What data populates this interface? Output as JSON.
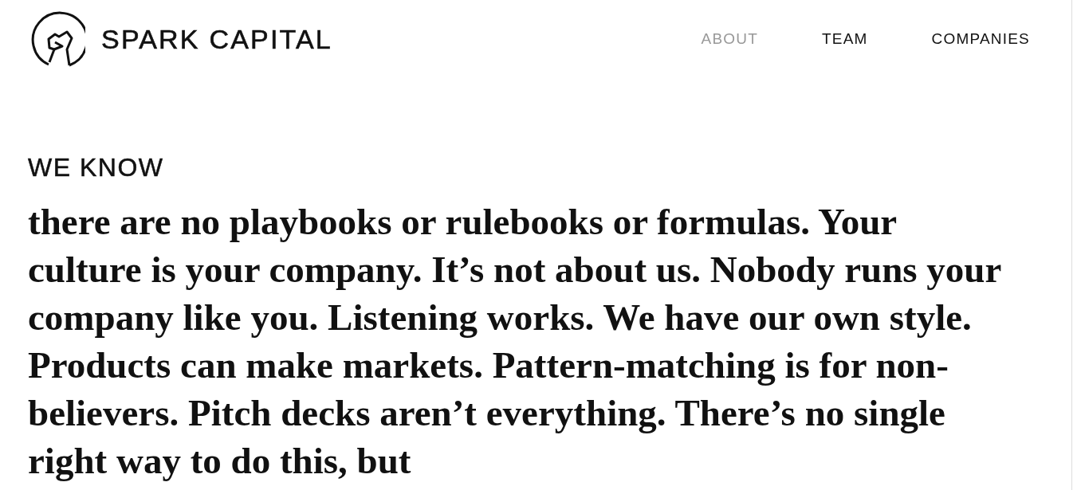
{
  "header": {
    "logo_text": "SPARK CAPITAL",
    "nav": [
      {
        "label": "ABOUT",
        "selected": true
      },
      {
        "label": "TEAM",
        "selected": false
      },
      {
        "label": "COMPANIES",
        "selected": false
      }
    ]
  },
  "intro": {
    "heading": "WE KNOW",
    "body": "there are no playbooks or rulebooks or formulas. Your culture is your company. It’s not about us. Nobody runs your company like you. Listening works. We have our own style. Products can make markets. Pattern-matching is for non-believers. Pitch decks aren’t everything. There’s no single right way to do this, but"
  }
}
